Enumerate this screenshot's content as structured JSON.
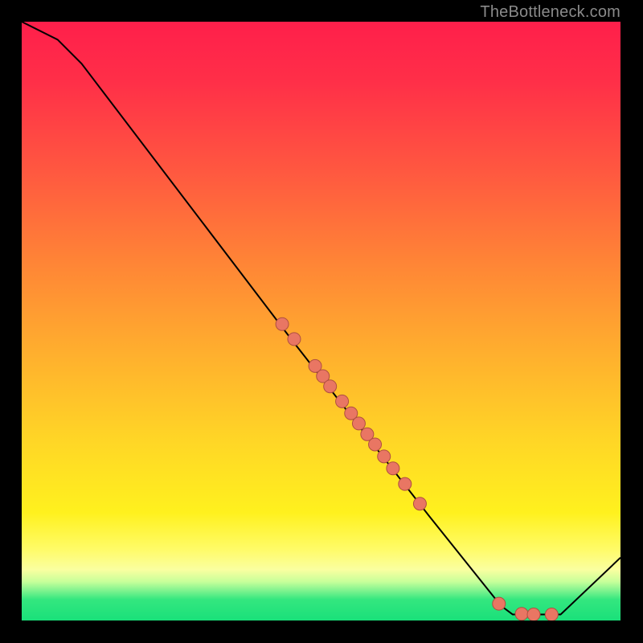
{
  "attribution": "TheBottleneck.com",
  "chart_data": {
    "type": "line",
    "title": "",
    "xlabel": "",
    "ylabel": "",
    "xlim": [
      0,
      100
    ],
    "ylim": [
      0,
      100
    ],
    "grid": false,
    "curve": [
      {
        "x": 0,
        "y": 100
      },
      {
        "x": 6,
        "y": 97
      },
      {
        "x": 10,
        "y": 93
      },
      {
        "x": 45,
        "y": 47
      },
      {
        "x": 68,
        "y": 17.5
      },
      {
        "x": 80,
        "y": 2.5
      },
      {
        "x": 82,
        "y": 1
      },
      {
        "x": 90,
        "y": 1
      },
      {
        "x": 100,
        "y": 10.5
      }
    ],
    "markers": [
      {
        "x": 43.5,
        "y": 49.5
      },
      {
        "x": 45.5,
        "y": 47.0
      },
      {
        "x": 49.0,
        "y": 42.5
      },
      {
        "x": 50.3,
        "y": 40.8
      },
      {
        "x": 51.5,
        "y": 39.1
      },
      {
        "x": 53.5,
        "y": 36.6
      },
      {
        "x": 55.0,
        "y": 34.6
      },
      {
        "x": 56.3,
        "y": 32.9
      },
      {
        "x": 57.7,
        "y": 31.1
      },
      {
        "x": 59.0,
        "y": 29.4
      },
      {
        "x": 60.5,
        "y": 27.4
      },
      {
        "x": 62.0,
        "y": 25.4
      },
      {
        "x": 64.0,
        "y": 22.8
      },
      {
        "x": 66.5,
        "y": 19.5
      },
      {
        "x": 79.7,
        "y": 2.8
      },
      {
        "x": 83.5,
        "y": 1.1
      },
      {
        "x": 85.5,
        "y": 1.0
      },
      {
        "x": 88.5,
        "y": 1.0
      }
    ],
    "line_style": {
      "color": "#000000",
      "width": 2
    },
    "marker_style": {
      "fill": "#e97663",
      "stroke": "#af4f40",
      "radius_px": 8
    }
  }
}
